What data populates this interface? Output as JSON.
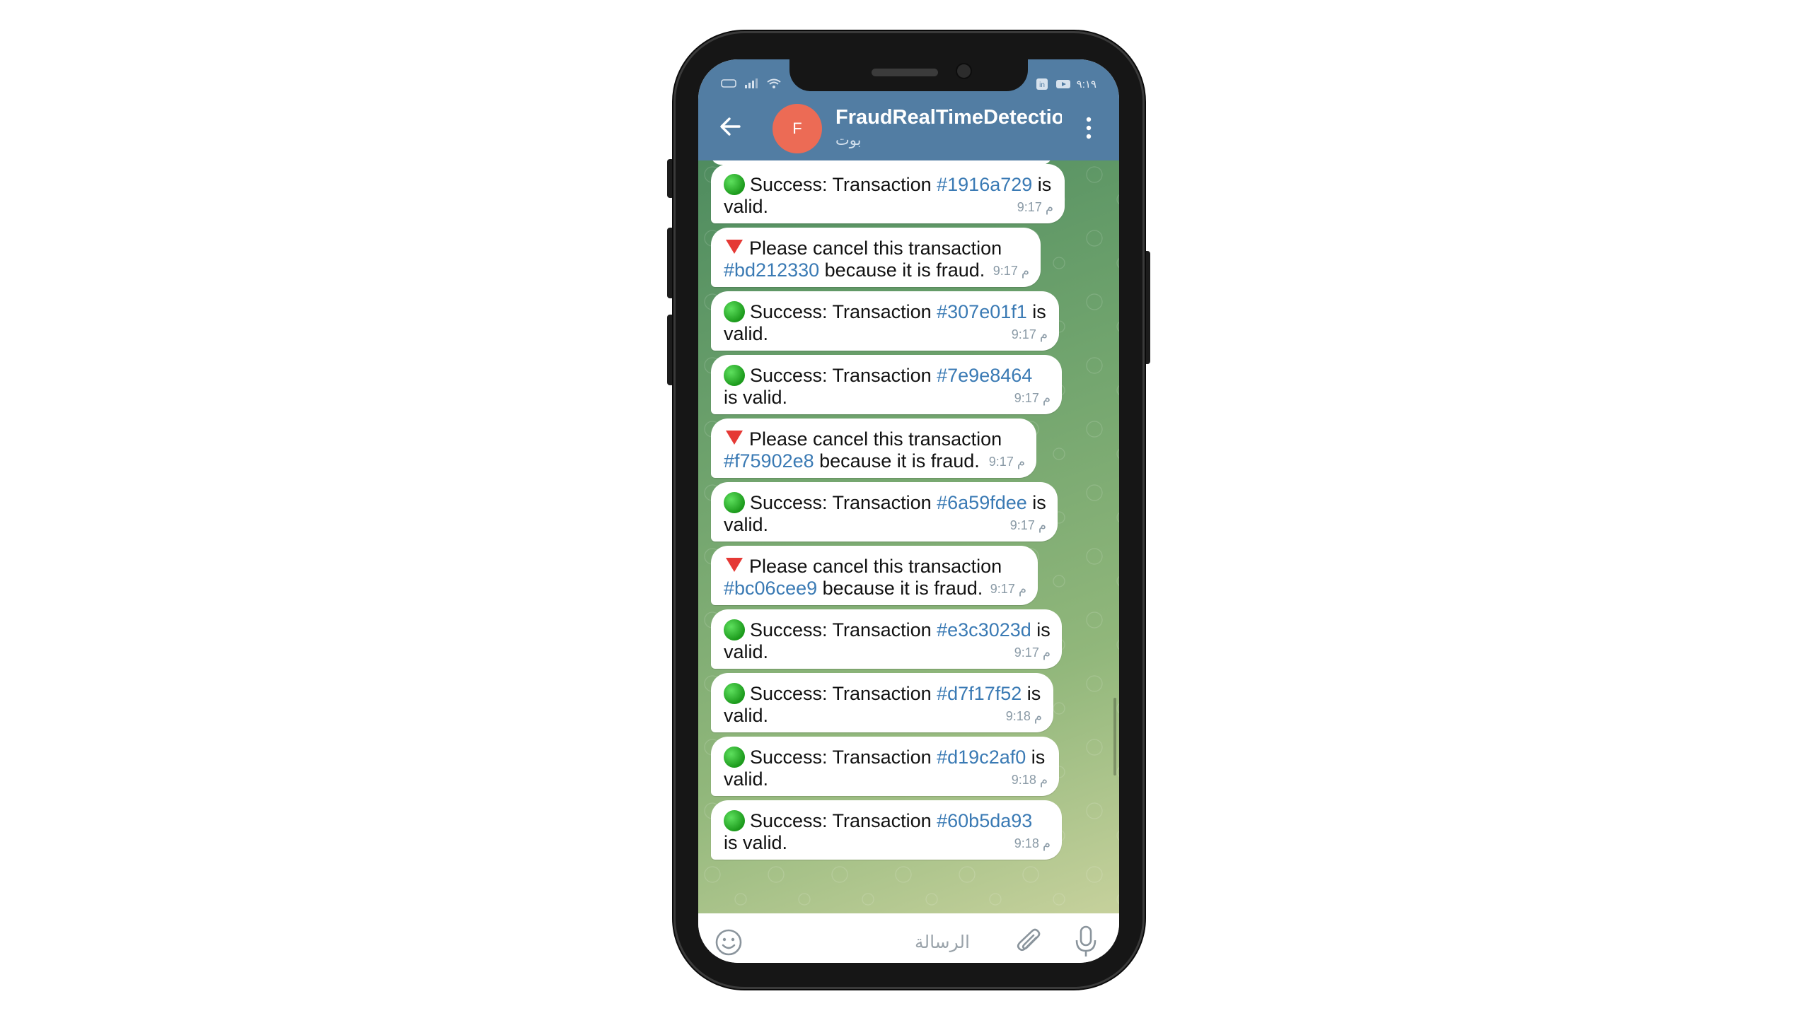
{
  "status_bar": {
    "time": "٩:١٩"
  },
  "header": {
    "avatar_letter": "F",
    "title": "FraudRealTimeDetection",
    "subtitle": "بوت"
  },
  "messages": [
    {
      "kind": "success",
      "prefix": "Success: Transaction ",
      "tx": "#1916a729",
      "suffix": " is valid.",
      "time": "9:17 م"
    },
    {
      "kind": "fraud",
      "prefix": "Please cancel this transaction ",
      "tx": "#bd212330",
      "suffix": " because it is fraud.",
      "time": "9:17 م"
    },
    {
      "kind": "success",
      "prefix": "Success: Transaction ",
      "tx": "#307e01f1",
      "suffix": " is valid.",
      "time": "9:17 م"
    },
    {
      "kind": "success",
      "prefix": "Success: Transaction ",
      "tx": "#7e9e8464",
      "suffix": " is valid.",
      "time": "9:17 م"
    },
    {
      "kind": "fraud",
      "prefix": "Please cancel this transaction ",
      "tx": "#f75902e8",
      "suffix": " because it is fraud.",
      "time": "9:17 م"
    },
    {
      "kind": "success",
      "prefix": "Success: Transaction ",
      "tx": "#6a59fdee",
      "suffix": " is valid.",
      "time": "9:17 م"
    },
    {
      "kind": "fraud",
      "prefix": "Please cancel this transaction ",
      "tx": "#bc06cee9",
      "suffix": " because it is fraud.",
      "time": "9:17 م"
    },
    {
      "kind": "success",
      "prefix": "Success: Transaction ",
      "tx": "#e3c3023d",
      "suffix": " is valid.",
      "time": "9:17 م"
    },
    {
      "kind": "success",
      "prefix": "Success: Transaction ",
      "tx": "#d7f17f52",
      "suffix": " is valid.",
      "time": "9:18 م"
    },
    {
      "kind": "success",
      "prefix": "Success: Transaction ",
      "tx": "#d19c2af0",
      "suffix": " is valid.",
      "time": "9:18 م"
    },
    {
      "kind": "success",
      "prefix": "Success: Transaction ",
      "tx": "#60b5da93",
      "suffix": " is valid.",
      "time": "9:18 م"
    }
  ],
  "input": {
    "placeholder": "الرسالة"
  },
  "icons": {
    "back": "back-arrow-icon",
    "menu": "more-vertical-icon",
    "success": "green-circle-icon",
    "fraud": "red-triangle-icon",
    "emoji": "smiley-icon",
    "attach": "paperclip-icon",
    "mic": "microphone-icon"
  },
  "colors": {
    "header": "#527da3",
    "link": "#3a7ab4",
    "avatar": "#ec6b55"
  }
}
